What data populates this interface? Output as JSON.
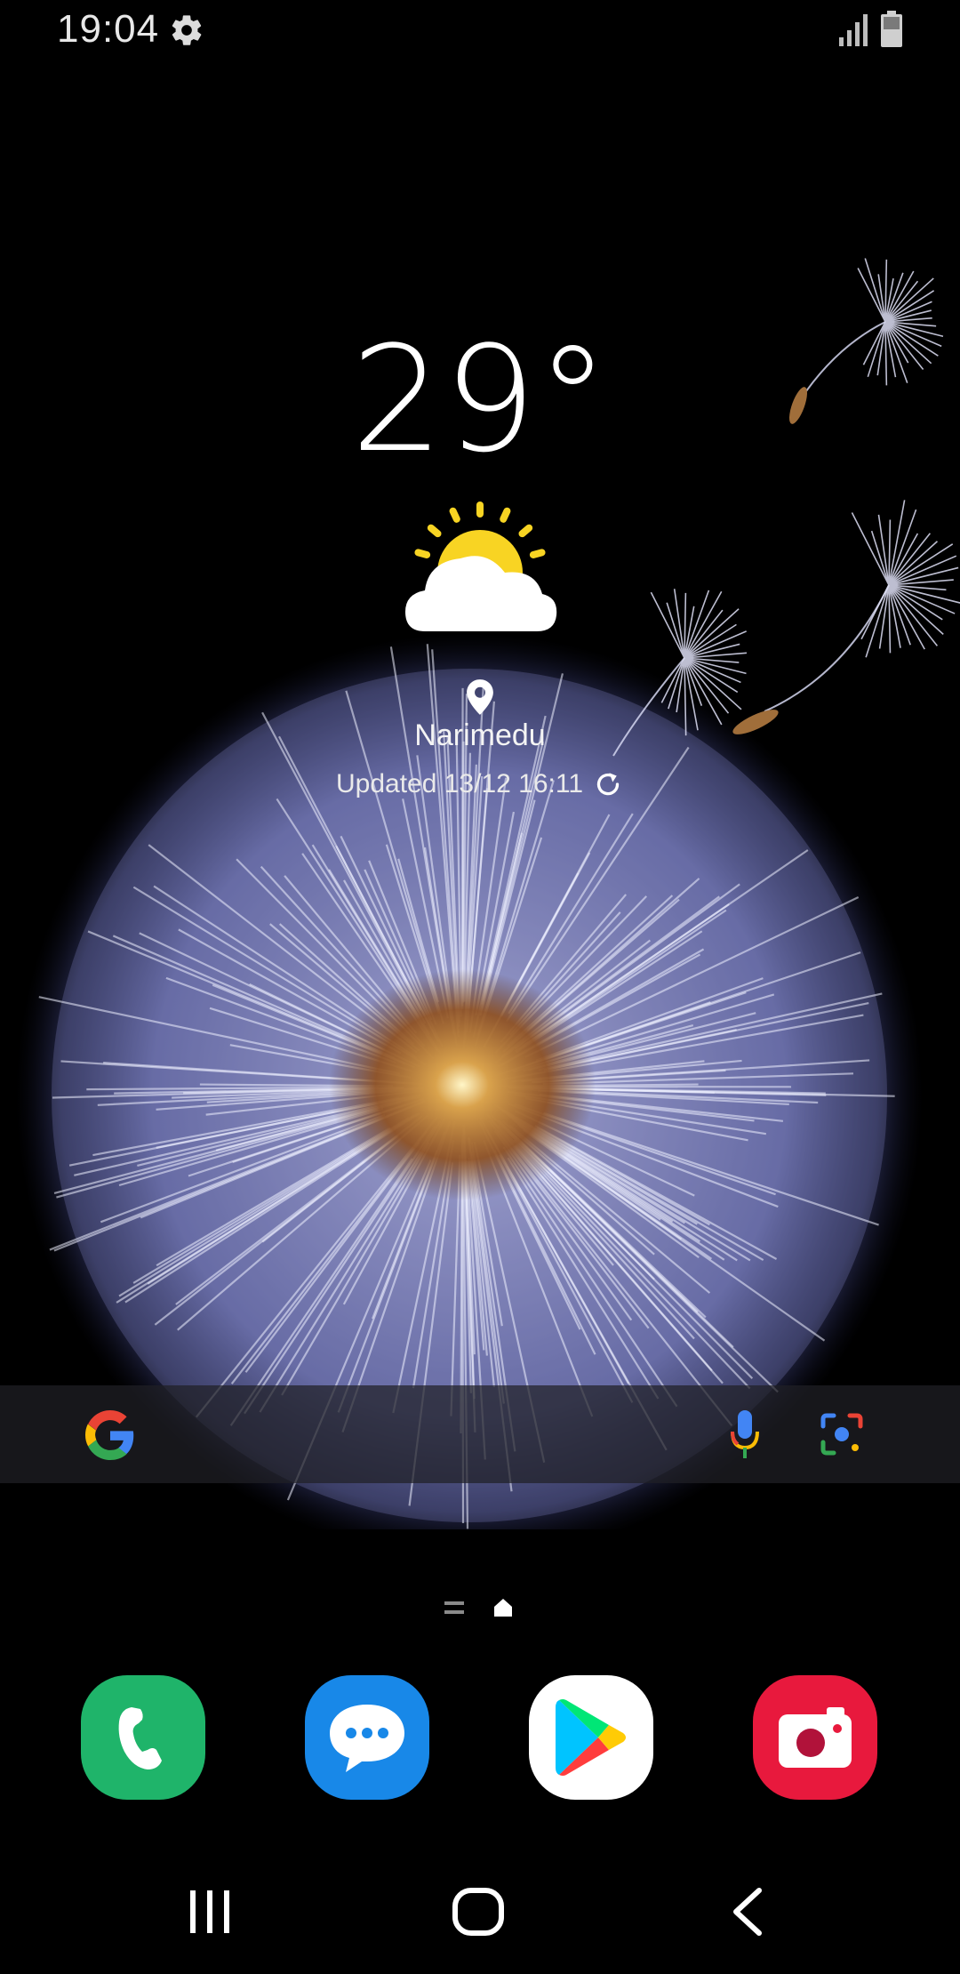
{
  "status_bar": {
    "time": "19:04",
    "icons": [
      "gear-icon",
      "signal-icon",
      "battery-icon"
    ]
  },
  "weather": {
    "temperature": "29°",
    "condition_icon": "partly-sunny-icon",
    "location": "Narimedu",
    "updated": "Updated 13/12 16:11"
  },
  "search_bar": {
    "placeholder": "",
    "icons": [
      "google-logo",
      "mic-icon",
      "lens-icon"
    ]
  },
  "page_indicator": {
    "pages": [
      "menu",
      "home"
    ],
    "active": "home"
  },
  "dock": {
    "apps": [
      {
        "name": "Phone",
        "icon": "phone-icon",
        "color": "#1fb46a"
      },
      {
        "name": "Messages",
        "icon": "messages-icon",
        "color": "#1888e8"
      },
      {
        "name": "Play Store",
        "icon": "play-store-icon",
        "color": "#ffffff"
      },
      {
        "name": "Camera",
        "icon": "camera-icon",
        "color": "#e8193d"
      }
    ]
  },
  "nav_bar": {
    "buttons": [
      "recents",
      "home",
      "back"
    ]
  },
  "colors": {
    "background": "#000000",
    "dandelion": "#8f95d8",
    "dandelion_center": "#a0622a",
    "sun": "#f8d423"
  }
}
